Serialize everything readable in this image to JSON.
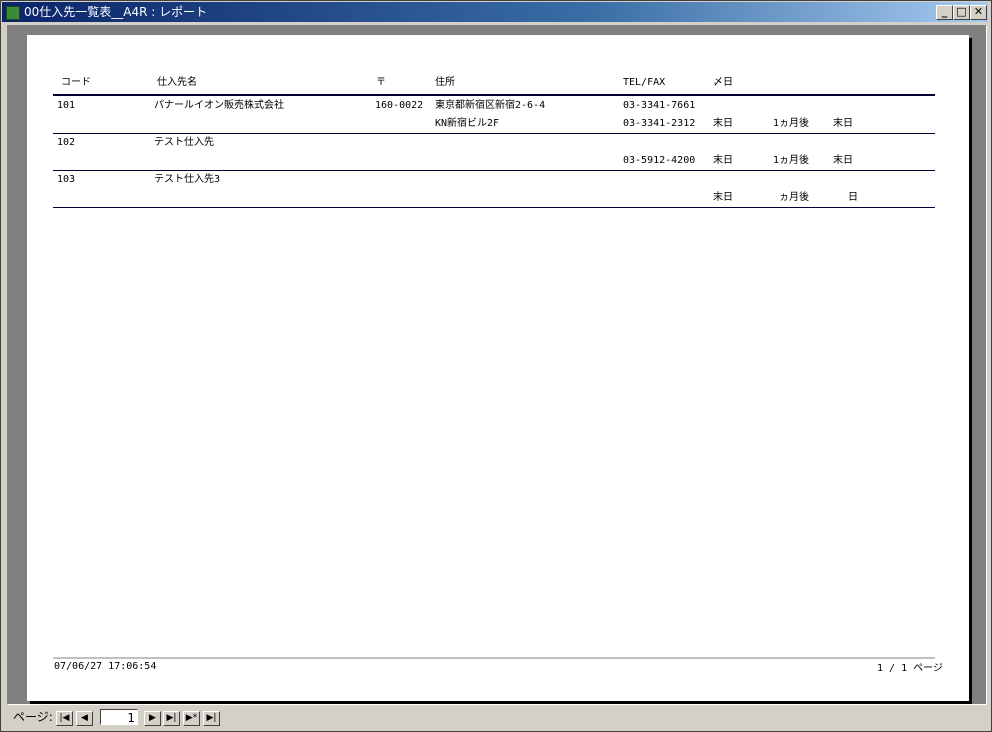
{
  "window": {
    "title": "00仕入先一覧表__A4R : レポート",
    "minimize": "_",
    "maximize": "□",
    "close": "✕"
  },
  "report": {
    "headers": {
      "code": "コード",
      "name": "仕入先名",
      "zip": "〒",
      "address": "住所",
      "telfax": "TEL/FAX",
      "closing": "〆日"
    },
    "rows": [
      {
        "code": "101",
        "name": "パナールイオン販売株式会社",
        "zip": "160-0022",
        "address1": "東京都新宿区新宿2-6-4",
        "address2": "KN新宿ビル2F",
        "tel": "03-3341-7661",
        "fax": "03-3341-2312",
        "closing": "末日",
        "pay_month": "1ヵ月後",
        "pay_day": "末日"
      },
      {
        "code": "102",
        "name": "テスト仕入先",
        "zip": "",
        "address1": "",
        "address2": "",
        "tel": "",
        "fax": "03-5912-4200",
        "closing": "末日",
        "pay_month": "1ヵ月後",
        "pay_day": "末日"
      },
      {
        "code": "103",
        "name": "テスト仕入先3",
        "zip": "",
        "address1": "",
        "address2": "",
        "tel": "",
        "fax": "",
        "closing": "末日",
        "pay_month": "ヵ月後",
        "pay_day": "日"
      }
    ],
    "footer": {
      "printed_at": "07/06/27 17:06:54",
      "page_info": "1 / 1 ページ"
    }
  },
  "navigation": {
    "label": "ページ:",
    "first": "|◀",
    "prev": "◀",
    "current_page": "1",
    "next": "▶",
    "last": "▶|",
    "new": "▶*",
    "end": "▶|"
  }
}
